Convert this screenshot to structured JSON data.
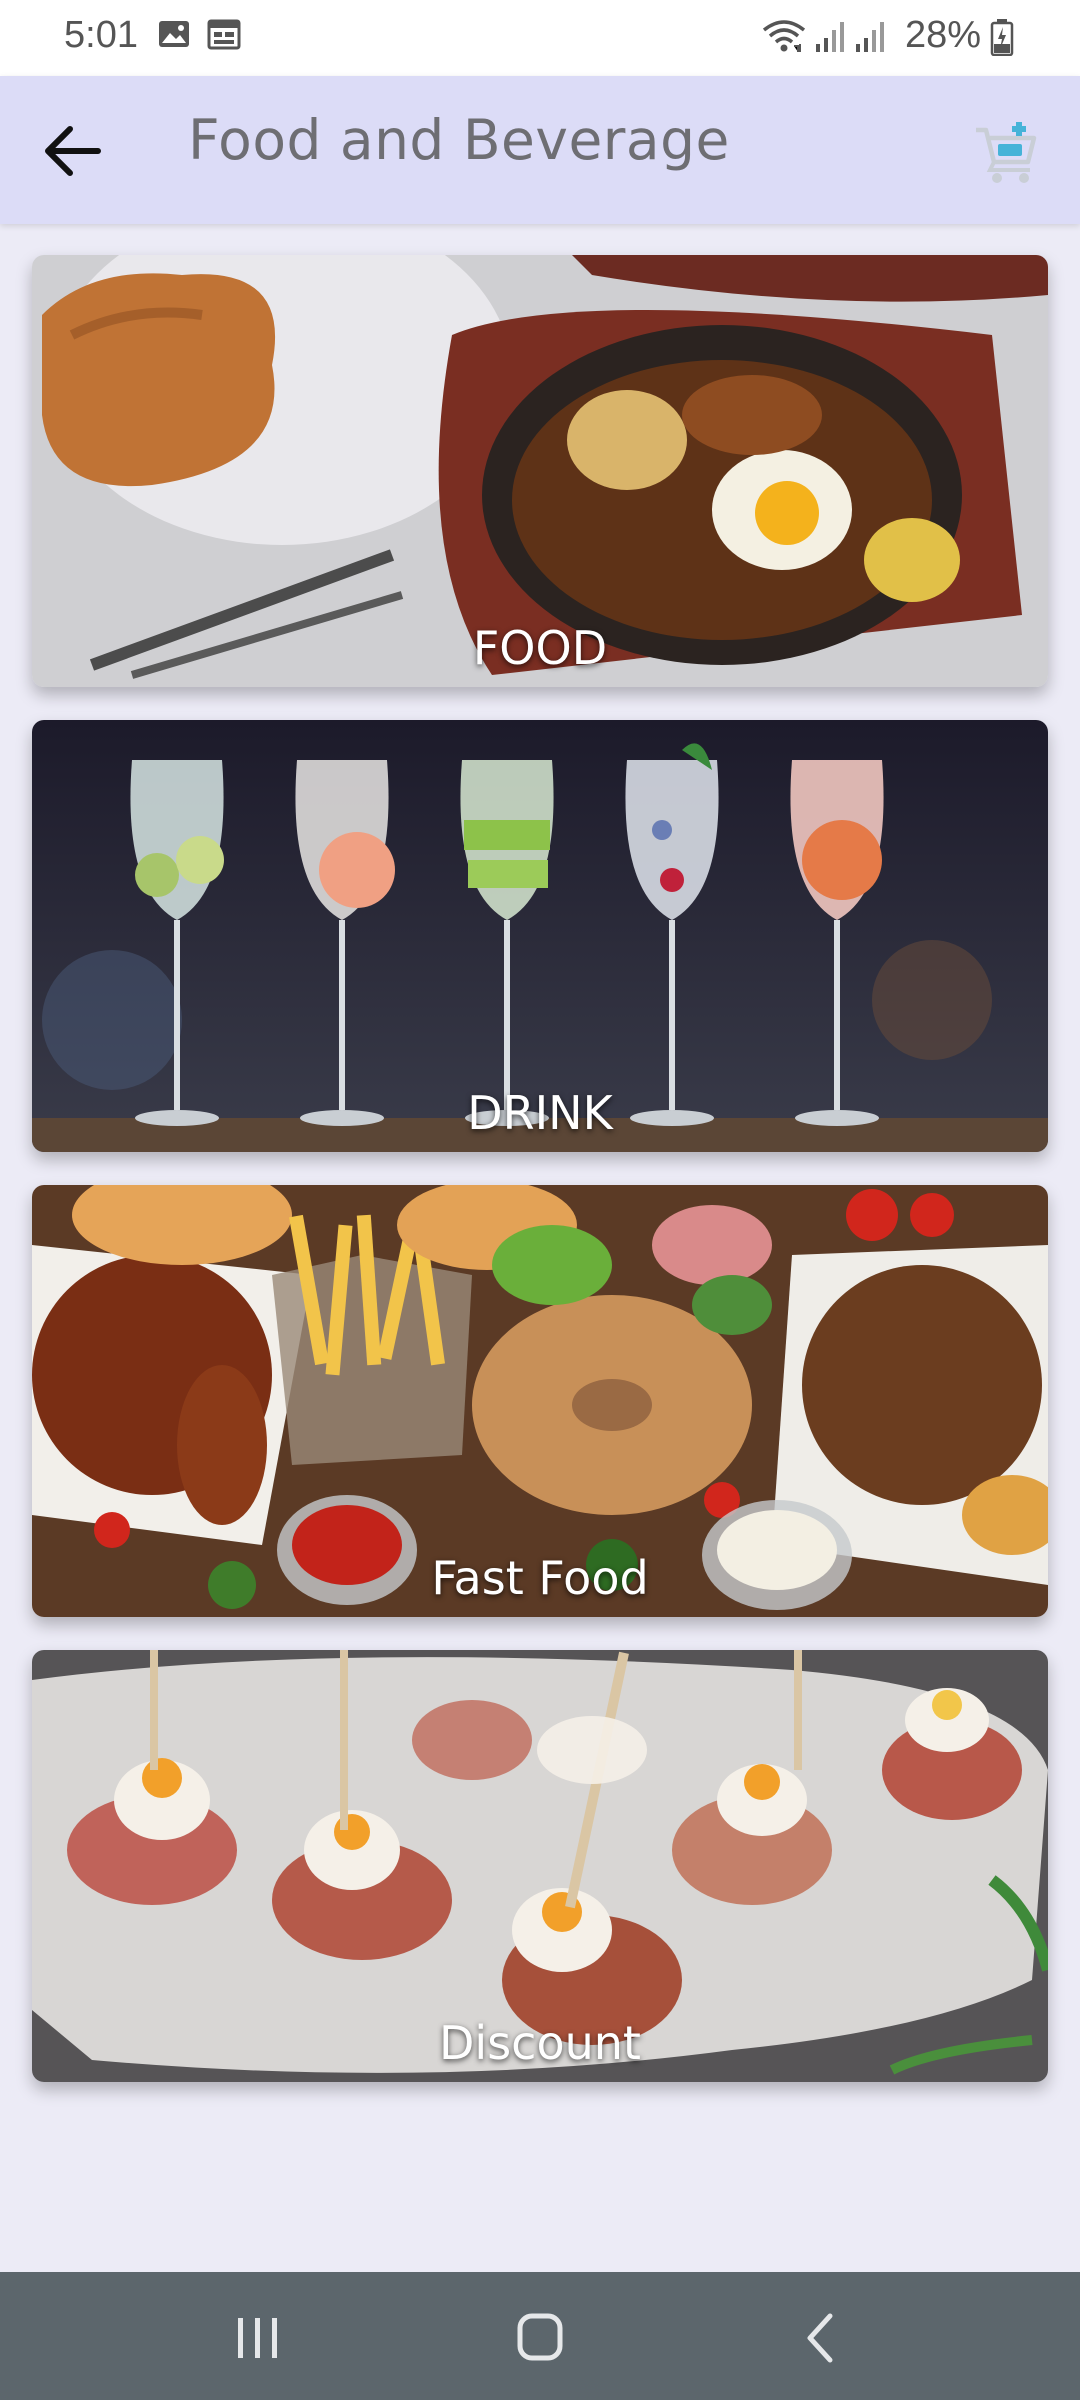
{
  "status_bar": {
    "time": "5:01",
    "battery": "28%",
    "icons": [
      "gallery-icon",
      "calendar-icon",
      "wifi-icon",
      "signal-icon",
      "signal-icon",
      "battery-icon"
    ]
  },
  "app_bar": {
    "title": "Food and Beverage",
    "back_icon": "arrow-left-icon",
    "cart_icon": "shopping-cart-icon"
  },
  "categories": [
    {
      "label": "FOOD"
    },
    {
      "label": "DRINK"
    },
    {
      "label": "Fast Food"
    },
    {
      "label": "Discount"
    }
  ],
  "nav_bar": {
    "icons": [
      "recent-apps-icon",
      "home-icon",
      "back-icon"
    ],
    "color": "#5C666C"
  },
  "colors": {
    "app_bar": "#DCDCF7",
    "background": "#ECEBF6",
    "title": "#6E6E73"
  }
}
